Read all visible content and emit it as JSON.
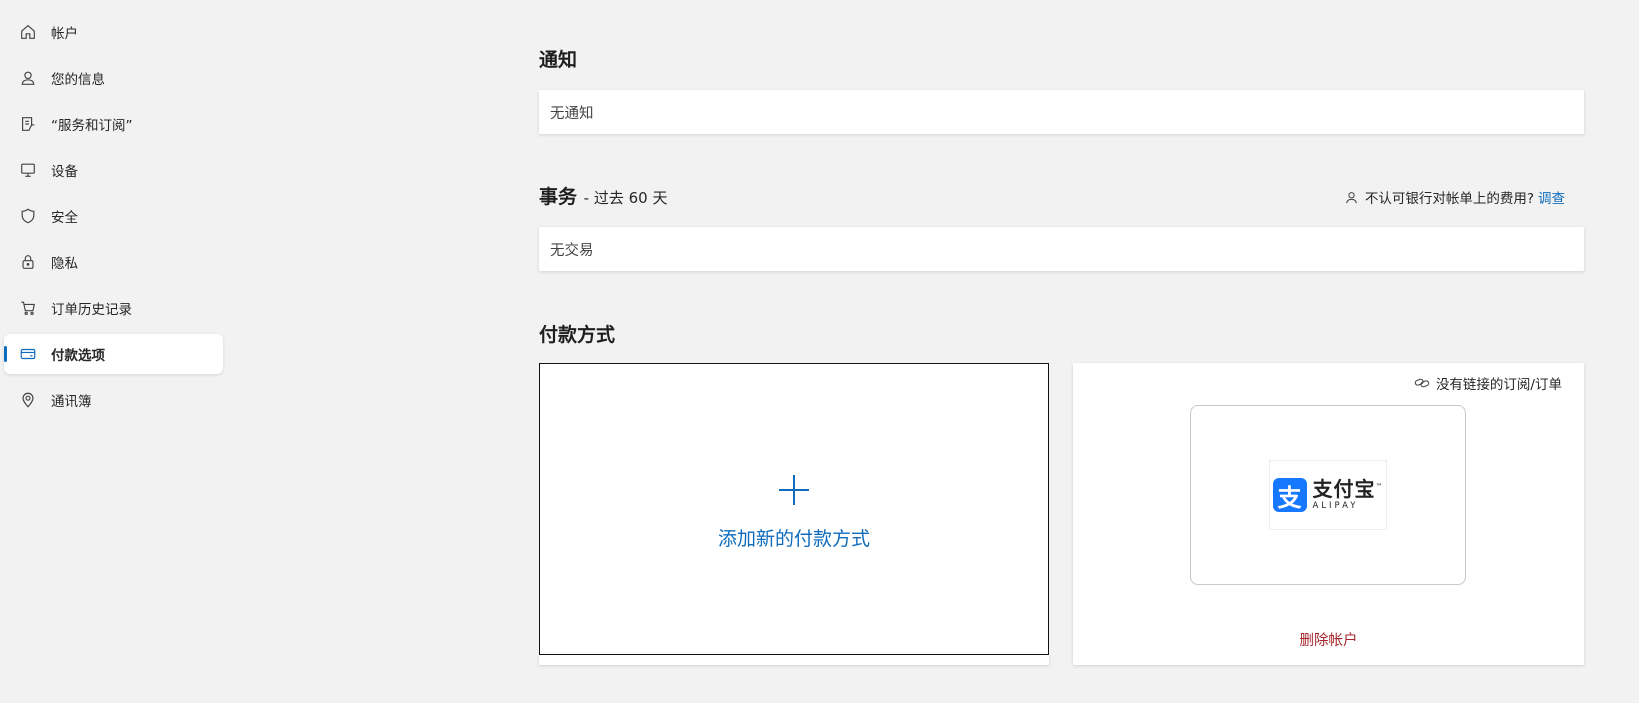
{
  "sidebar": {
    "items": [
      {
        "label": "帐户",
        "icon": "home-icon"
      },
      {
        "label": "您的信息",
        "icon": "person-icon"
      },
      {
        "label": "“服务和订阅”",
        "icon": "subscription-icon"
      },
      {
        "label": "设备",
        "icon": "monitor-icon"
      },
      {
        "label": "安全",
        "icon": "shield-icon"
      },
      {
        "label": "隐私",
        "icon": "lock-icon"
      },
      {
        "label": "订单历史记录",
        "icon": "cart-icon"
      },
      {
        "label": "付款选项",
        "icon": "card-icon",
        "active": true
      },
      {
        "label": "通讯簿",
        "icon": "location-pin-icon"
      }
    ],
    "accent_color": "#0f6cbd"
  },
  "notifications": {
    "title": "通知",
    "empty_text": "无通知"
  },
  "transactions": {
    "title": "事务",
    "subtitle": "- 过去 60 天",
    "dispute_text": "不认可银行对帐单上的费用?",
    "dispute_link": "调查",
    "empty_text": "无交易"
  },
  "payment": {
    "title": "付款方式",
    "add_label": "添加新的付款方式",
    "linked_text": "没有链接的订阅/订单",
    "alipay": {
      "cn": "支付宝",
      "en": "ALIPAY",
      "mark": "支",
      "tm": "™",
      "brand_color": "#1677ff"
    },
    "delete_label": "删除帐户"
  }
}
